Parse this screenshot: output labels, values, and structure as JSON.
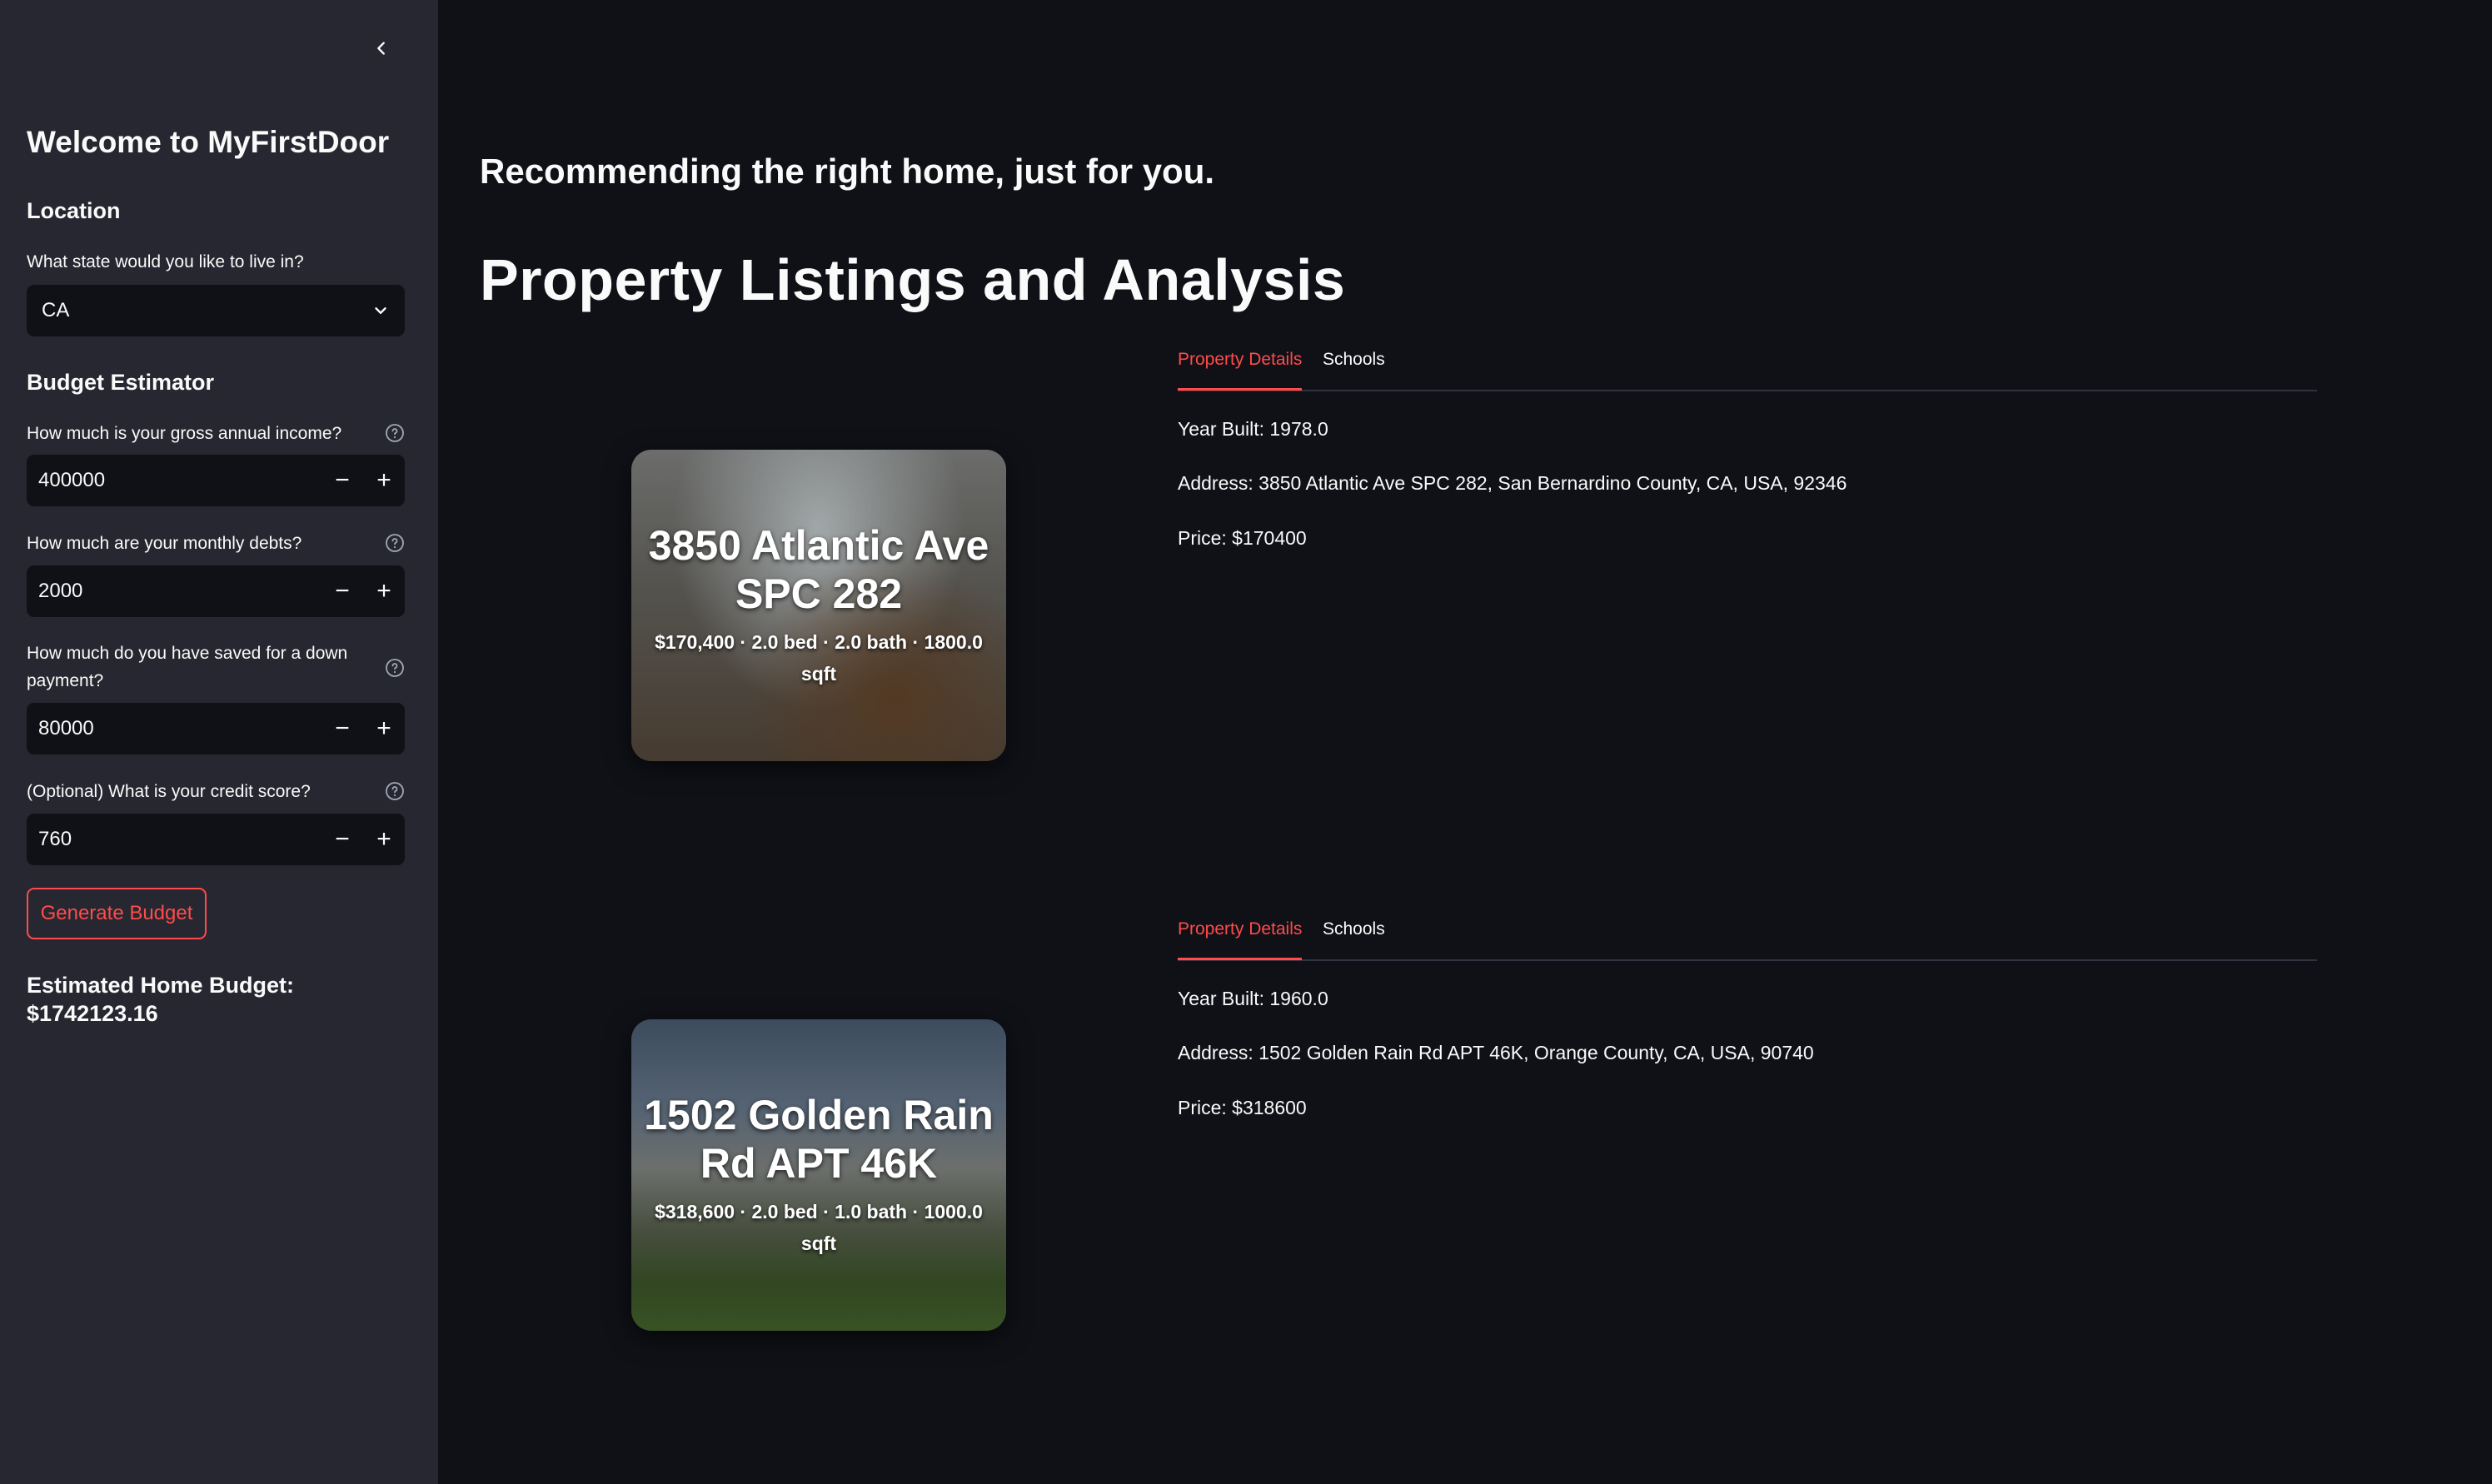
{
  "sidebar": {
    "title": "Welcome to MyFirstDoor",
    "location": {
      "heading": "Location",
      "state_label": "What state would you like to live in?",
      "state_value": "CA"
    },
    "budget": {
      "heading": "Budget Estimator",
      "income_label": "How much is your gross annual income?",
      "income_value": "400000",
      "debts_label": "How much are your monthly debts?",
      "debts_value": "2000",
      "down_label": "How much do you have saved for a down payment?",
      "down_value": "80000",
      "credit_label": "(Optional) What is your credit score?",
      "credit_value": "760",
      "button_label": "Generate Budget",
      "result_label": "Estimated Home Budget:",
      "result_value": "$1742123.16"
    }
  },
  "main": {
    "subtitle": "Recommending the right home, just for you.",
    "title": "Property Listings and Analysis",
    "listings": [
      {
        "card_title": "3850 Atlantic Ave SPC 282",
        "card_meta": "$170,400 · 2.0 bed · 2.0 bath · 1800.0 sqft",
        "tab_details": "Property Details",
        "tab_schools": "Schools",
        "year_built": "Year Built: 1978.0",
        "address": "Address: 3850 Atlantic Ave SPC 282, San Bernardino County, CA, USA, 92346",
        "price": "Price: $170400"
      },
      {
        "card_title": "1502 Golden Rain Rd APT 46K",
        "card_meta": "$318,600 · 2.0 bed · 1.0 bath · 1000.0 sqft",
        "tab_details": "Property Details",
        "tab_schools": "Schools",
        "year_built": "Year Built: 1960.0",
        "address": "Address: 1502 Golden Rain Rd APT 46K, Orange County, CA, USA, 90740",
        "price": "Price: $318600"
      }
    ]
  },
  "colors": {
    "sidebar_bg": "#262730",
    "main_bg": "#0f1117",
    "accent": "#ff4b4b"
  },
  "icons": {
    "collapse": "chevron-left-icon",
    "select": "chevron-down-icon",
    "help": "question-circle-icon",
    "minus": "minus-icon",
    "plus": "plus-icon"
  }
}
